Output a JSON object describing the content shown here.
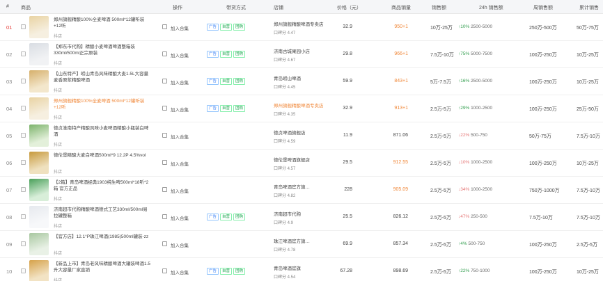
{
  "columns": {
    "idx": "#",
    "product": "商品",
    "action": "操作",
    "sell_mode": "带货方式",
    "store": "店铺",
    "price": "价格（元）",
    "sales": "商品销量",
    "gmv": "销售额",
    "sales_24h": "24h 销售额",
    "weekly_sales": "周销售额",
    "total_sales": "累计销售"
  },
  "action_label": "加入合集",
  "shop_label": "抖店",
  "colors": {
    "orange": "#f0883a",
    "red": "#e53935",
    "green": "#2e9c4b"
  },
  "rows": [
    {
      "idx": "01",
      "title": "郑州旗舰精酿100%全麦啤酒 500ml*12罐听装+12听",
      "tags": [
        "广告",
        "自营",
        "团购"
      ],
      "store": "郑州旗舰精酿啤酒专卖店",
      "score": "口碑分 4.47",
      "price": "32.9",
      "sales": "950+1",
      "gmv": "10万-25万",
      "trend": "↑10% 2500-5000",
      "weekly": "250万-500万",
      "total": "50万-75万"
    },
    {
      "idx": "02",
      "title": "【郑东市代购】精酿小麦啤酒啤酒整箱装330ml/500ml正宗原装",
      "tags": [
        "广告",
        "自营",
        "团购"
      ],
      "store": "济南古城果园小店",
      "score": "口碑分 4.67",
      "price": "29.8",
      "sales": "966+1",
      "gmv": "7.5万-10万",
      "trend": "↑75% 5000-7500",
      "weekly": "100万-250万",
      "total": "10万-25万"
    },
    {
      "idx": "03",
      "title": "【山东特产】崂山青岛风味精酿大麦1.5L大容量麦香原浆精酿啤酒",
      "tags": [
        "广告",
        "自营",
        "团购"
      ],
      "store": "青岛崂山啤酒",
      "score": "口碑分 4.45",
      "price": "59.9",
      "sales": "843+1",
      "gmv": "5万-7.5万",
      "trend": "↑16% 2500-5000",
      "weekly": "100万-250万",
      "total": "10万-25万"
    },
    {
      "idx": "04",
      "title": "郑州旗舰精酿100%全麦啤酒 500ml*12罐听装+12听",
      "tags": [
        "广告",
        "自营",
        "团购"
      ],
      "store": "郑州旗舰精酿啤酒专卖店",
      "score": "口碑分 4.35",
      "price": "32.9",
      "sales": "913+1",
      "gmv": "2.5万-5万",
      "trend": "↑29% 1000-2500",
      "weekly": "100万-250万",
      "total": "25万-50万"
    },
    {
      "idx": "05",
      "title": "德贞淮南特产精酿风味小麦啤酒精酿小瓶装白啤酒",
      "tags": [],
      "store": "德贞啤酒旗舰店",
      "score": "口碑分 4.59",
      "price": "11.9",
      "sales": "871.06",
      "gmv": "2.5万-5万",
      "trend": "↓22% 500-750",
      "weekly": "50万-75万",
      "total": "7.5万-10万"
    },
    {
      "idx": "06",
      "title": "德伦堡精酿大麦白啤酒500ml*9 12.2P 4.5%vol",
      "tags": [],
      "store": "德伦堡啤酒旗舰店",
      "score": "口碑分 4.57",
      "price": "29.5",
      "sales": "912.55",
      "gmv": "2.5万-5万",
      "trend": "↓10% 1000-2500",
      "weekly": "100万-250万",
      "total": "10万-25万"
    },
    {
      "idx": "07",
      "title": "【2箱】青岛啤酒经典1903纯生啤500ml*18听*2箱 官方正品",
      "tags": [],
      "store": "青岛啤酒官方旗…",
      "score": "口碑分 4.82",
      "price": "228",
      "sales": "905.09",
      "gmv": "2.5万-5万",
      "trend": "↓34% 1000-2500",
      "weekly": "750万-1000万",
      "total": "7.5万-10万"
    },
    {
      "idx": "08",
      "title": "济南超市代购精酿啤酒德式工艺330ml/500ml易拉罐整箱",
      "tags": [
        "广告",
        "自营",
        "团购"
      ],
      "store": "济南超市代购",
      "score": "口碑分 4.9",
      "price": "25.5",
      "sales": "826.12",
      "gmv": "2.5万-5万",
      "trend": "↓47% 250-500",
      "weekly": "7.5万-10万",
      "total": "7.5万-10万"
    },
    {
      "idx": "09",
      "title": "【官方店】12.1°P珠江啤酒(1985)500ml罐装-zz",
      "tags": [],
      "store": "珠江啤酒官方旗…",
      "score": "口碑分 4.78",
      "price": "69.9",
      "sales": "857.34",
      "gmv": "2.5万-5万",
      "trend": "↑4% 500-750",
      "weekly": "100万-250万",
      "total": "2.5万-5万"
    },
    {
      "idx": "10",
      "title": "【新品上市】青岛老风味精酿啤酒大罐装啤酒1.5升大容量厂家直销",
      "tags": [
        "广告",
        "自营",
        "团购"
      ],
      "store": "青岛啤酒官旗",
      "score": "口碑分 4.54",
      "price": "67.28",
      "sales": "898.69",
      "gmv": "2.5万-5万",
      "trend": "↑22% 750-1000",
      "weekly": "100万-250万",
      "total": "10万-25万"
    }
  ]
}
